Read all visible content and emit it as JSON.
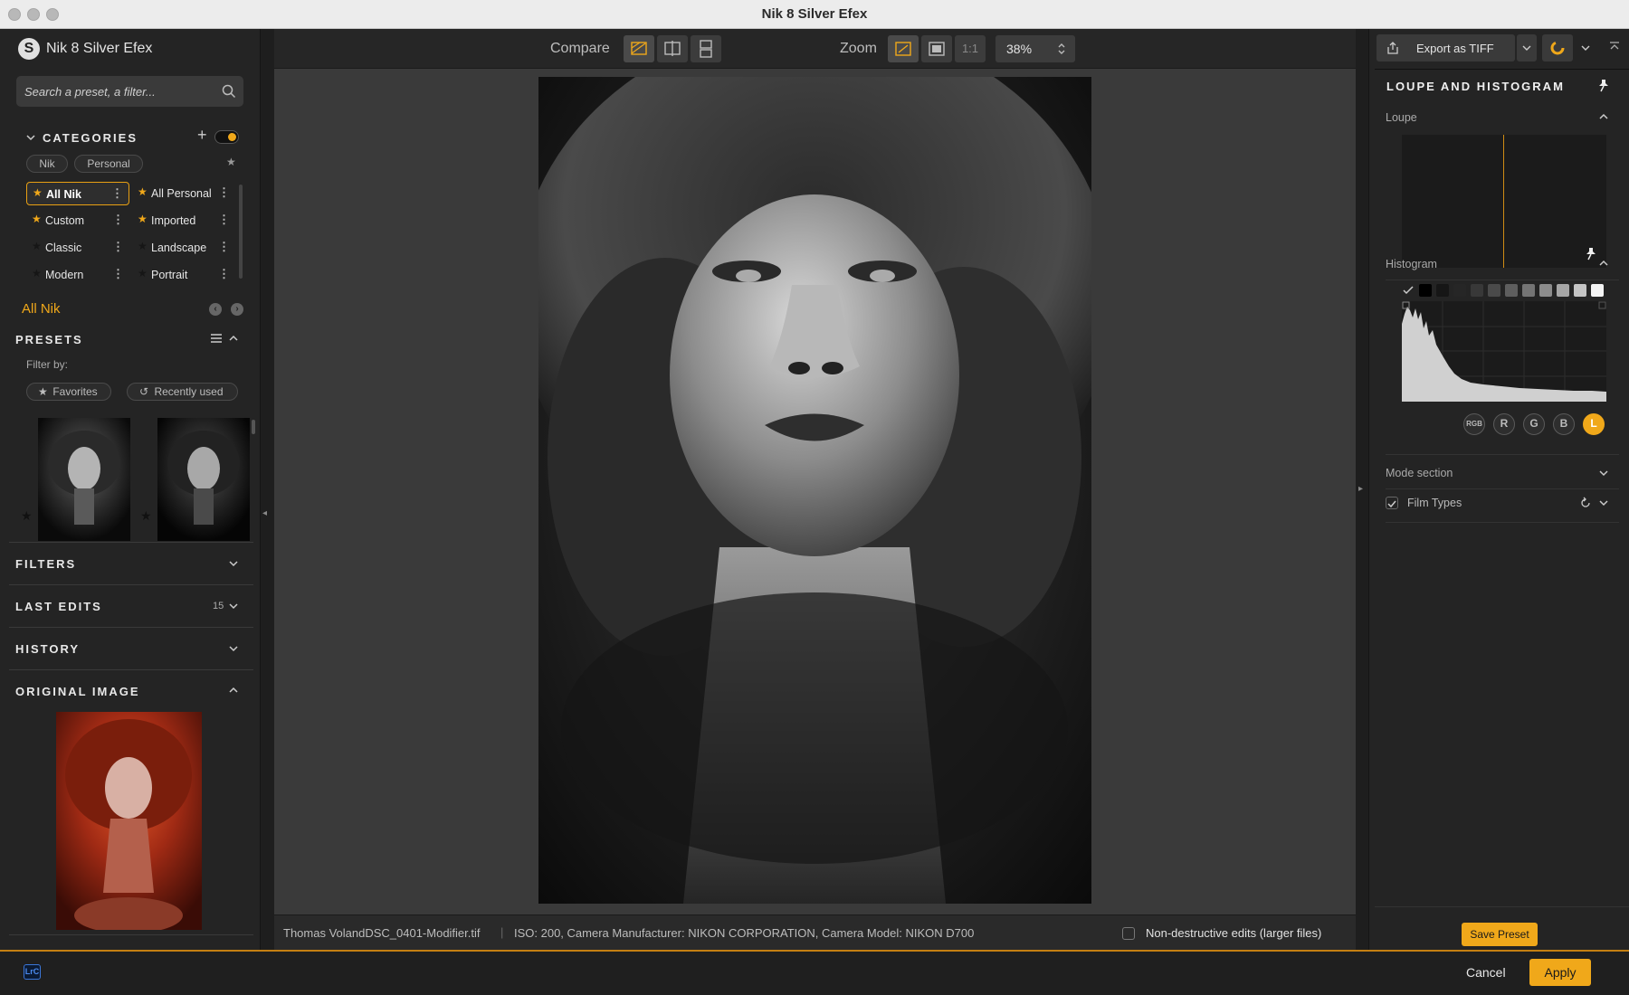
{
  "window": {
    "title": "Nik 8 Silver Efex"
  },
  "left_panel": {
    "app_name": "Nik 8 Silver Efex",
    "logo_letter": "S",
    "search_placeholder": "Search a preset, a filter...",
    "categories": {
      "header": "CATEGORIES",
      "chips": [
        "Nik",
        "Personal"
      ],
      "items": [
        {
          "label": "All Nik",
          "starred": true,
          "selected": true
        },
        {
          "label": "All Personal",
          "starred": true,
          "selected": false
        },
        {
          "label": "Custom",
          "starred": true,
          "selected": false
        },
        {
          "label": "Imported",
          "starred": true,
          "selected": false
        },
        {
          "label": "Classic",
          "starred": false,
          "selected": false
        },
        {
          "label": "Landscape",
          "starred": false,
          "selected": false
        },
        {
          "label": "Modern",
          "starred": false,
          "selected": false
        },
        {
          "label": "Portrait",
          "starred": false,
          "selected": false
        }
      ]
    },
    "current_category": "All Nik",
    "presets": {
      "header": "PRESETS",
      "filter_by_label": "Filter by:",
      "favorites_label": "Favorites",
      "recently_used_label": "Recently used"
    },
    "filters_header": "FILTERS",
    "last_edits": {
      "header": "LAST EDITS",
      "count": "15"
    },
    "history_header": "HISTORY",
    "original_image_header": "ORIGINAL IMAGE"
  },
  "toolbar": {
    "compare_label": "Compare",
    "zoom_label": "Zoom",
    "one_to_one": "1:1",
    "zoom_value": "38%"
  },
  "status": {
    "filename": "Thomas VolandDSC_0401-Modifier.tif",
    "exif": "ISO: 200, Camera Manufacturer: NIKON CORPORATION, Camera Model: NIKON D700",
    "nondestructive_label": "Non-destructive edits (larger files)"
  },
  "right_panel": {
    "export_label": "Export as TIFF",
    "section_title": "LOUPE AND HISTOGRAM",
    "loupe_label": "Loupe",
    "histogram_label": "Histogram",
    "channels": [
      "RGB",
      "R",
      "G",
      "B",
      "L"
    ],
    "active_channel": "L",
    "mode_section_label": "Mode section",
    "film_types_label": "Film Types",
    "save_preset_label": "Save Preset"
  },
  "footer": {
    "lrc_badge": "LrC",
    "cancel_label": "Cancel",
    "apply_label": "Apply"
  },
  "colors": {
    "accent": "#f0a81a",
    "panel_bg": "#242424",
    "canvas_bg": "#3a3a3a"
  }
}
